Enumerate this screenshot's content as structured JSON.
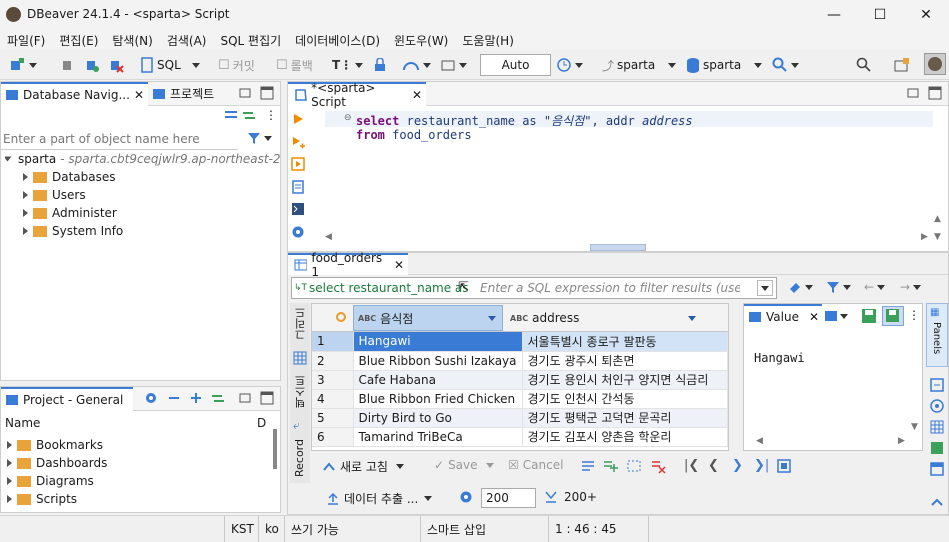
{
  "window": {
    "title": "DBeaver 24.1.4 - <sparta> Script"
  },
  "menu": [
    "파일(F)",
    "편집(E)",
    "탐색(N)",
    "검색(A)",
    "SQL 편집기",
    "데이터베이스(D)",
    "윈도우(W)",
    "도움말(H)"
  ],
  "toolbar": {
    "sql_label": "SQL",
    "commit_label": "커밋",
    "rollback_label": "롤백",
    "auto_value": "Auto",
    "datasource_label": "sparta",
    "schema_label": "sparta"
  },
  "navigator": {
    "tab_label": "Database Navig...",
    "projects_tab_label": "프로젝트",
    "filter_placeholder": "Enter a part of object name here",
    "connection_name": "sparta",
    "connection_host": "- sparta.cbt9ceqjwlr9.ap-northeast-2.r",
    "items": [
      "Databases",
      "Users",
      "Administer",
      "System Info"
    ]
  },
  "project": {
    "tab_label": "Project - General",
    "col_name": "Name",
    "col_d": "D",
    "items": [
      "Bookmarks",
      "Dashboards",
      "Diagrams",
      "Scripts"
    ]
  },
  "editor": {
    "tab_label": "*<sparta> Script",
    "line1": {
      "kw_select": "select",
      "cols": "restaurant_name",
      "kw_as": "as",
      "alias1": "\"음식점\"",
      "comma_addr": ", addr",
      "alias2": "address"
    },
    "line2": {
      "kw_from": "from",
      "table": "food_orders"
    }
  },
  "results": {
    "tab_label": "food_orders 1",
    "query_snippet": "select restaurant_name as",
    "filter_placeholder": "Enter a SQL expression to filter results (use Ctrl+",
    "columns": [
      "음식점",
      "address"
    ],
    "rows": [
      {
        "n": "1",
        "name": "Hangawi",
        "addr": "서울특별시 종로구 팔판동"
      },
      {
        "n": "2",
        "name": "Blue Ribbon Sushi Izakaya",
        "addr": "경기도 광주시 퇴촌면"
      },
      {
        "n": "3",
        "name": "Cafe Habana",
        "addr": "경기도 용인시 처인구 양지면 식금리"
      },
      {
        "n": "4",
        "name": "Blue Ribbon Fried Chicken",
        "addr": "경기도 인천시 간석동"
      },
      {
        "n": "5",
        "name": "Dirty Bird to Go",
        "addr": "경기도 평택군 고덕면 문곡리"
      },
      {
        "n": "6",
        "name": "Tamarind TriBeCa",
        "addr": "경기도 김포시 양촌읍 학운리"
      }
    ],
    "side_tabs": {
      "grid": "그리드",
      "text": "텍스트",
      "record": "Record"
    },
    "refresh_label": "새로 고침",
    "save_label": "Save",
    "cancel_label": "Cancel",
    "export_label": "데이터 추출 ...",
    "fetch_size": "200",
    "fetch_all_label": "200+"
  },
  "value_panel": {
    "tab_label": "Value",
    "content": "Hangawi",
    "panels_label": "Panels"
  },
  "status": {
    "tz": "KST",
    "locale": "ko",
    "mode": "쓰기 가능",
    "insert": "스마트 삽입",
    "pos": "1 : 46 : 45"
  }
}
